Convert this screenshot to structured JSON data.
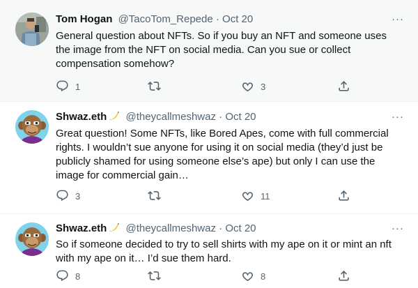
{
  "tweets": [
    {
      "author_name": "Tom Hogan",
      "handle": "@TacoTom_Repede",
      "separator": "·",
      "date": "Oct 20",
      "more": "···",
      "text": "General question about NFTs. So if you buy an NFT and someone uses the image from the NFT on social media. Can you sue or collect compensation somehow?",
      "reply_count": "1",
      "retweet_count": "",
      "like_count": "3"
    },
    {
      "author_name": "Shwaz.eth",
      "handle": "@theycallmeshwaz",
      "separator": "·",
      "date": "Oct 20",
      "more": "···",
      "text": "Great question! Some NFTs, like Bored Apes, come with full commercial rights. I wouldn’t sue anyone for using it on social media (they’d just be publicly shamed for using someone else’s ape) but only I can use the image for commercial gain…",
      "reply_count": "3",
      "retweet_count": "",
      "like_count": "11"
    },
    {
      "author_name": "Shwaz.eth",
      "handle": "@theycallmeshwaz",
      "separator": "·",
      "date": "Oct 20",
      "more": "···",
      "text": "So if someone decided to try to sell shirts with my ape on it or mint an nft with my ape on it… I’d sue them hard.",
      "reply_count": "8",
      "retweet_count": "",
      "like_count": "8"
    }
  ],
  "icons": {
    "reply": "reply-icon",
    "retweet": "retweet-icon",
    "like": "heart-icon",
    "share": "share-icon",
    "name_emoji": "banana-emoji"
  },
  "colors": {
    "text_primary": "#0f1419",
    "text_secondary": "#536471",
    "highlight_bg": "#f7f9f9",
    "divider": "#eff3f4"
  }
}
